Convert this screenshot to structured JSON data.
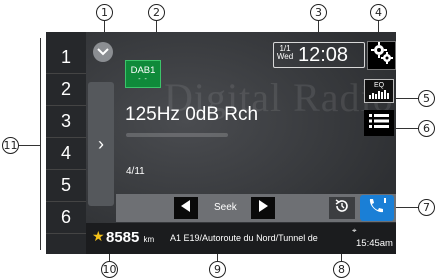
{
  "callouts": {
    "c1": "1",
    "c2": "2",
    "c3": "3",
    "c4": "4",
    "c5": "5",
    "c6": "6",
    "c7": "7",
    "c8": "8",
    "c9": "9",
    "c10": "10",
    "c11": "11"
  },
  "presets": [
    "1",
    "2",
    "3",
    "4",
    "5",
    "6"
  ],
  "watermark": "Digital Radio",
  "band": {
    "label": "DAB1",
    "dash": "- -"
  },
  "date": {
    "day": "1/1",
    "weekday": "Wed"
  },
  "clock": "12:08",
  "eq": {
    "label": "EQ"
  },
  "station": "125Hz 0dB Rch",
  "counter": "4/11",
  "seek": {
    "label": "Seek"
  },
  "expand": {
    "symbol": "›"
  },
  "status": {
    "distance_value": "8585",
    "distance_unit": "km",
    "street": "A1 E19/Autoroute du Nord/Tunnel de",
    "time": "15:45am"
  },
  "icons": {
    "collapse": "chevron-down-icon",
    "settings": "gear-icon",
    "list": "list-icon",
    "history": "history-icon",
    "phone": "phone-icon",
    "seek_prev": "triangle-left-icon",
    "seek_next": "triangle-right-icon",
    "star": "star-icon"
  }
}
